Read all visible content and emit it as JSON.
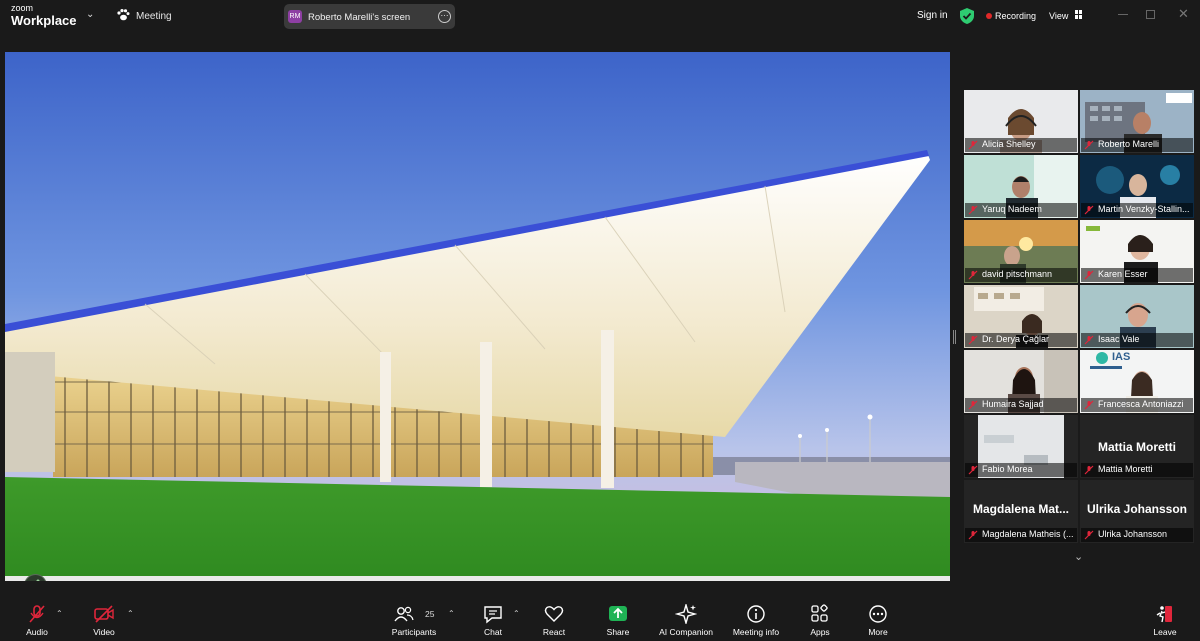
{
  "app": {
    "brand_small": "zoom",
    "brand_large": "Workplace",
    "meeting_label": "Meeting"
  },
  "screen_share": {
    "avatar_initials": "RM",
    "label": "Roberto Marelli's screen"
  },
  "top_right": {
    "sign_in": "Sign in",
    "recording": "Recording",
    "view": "View"
  },
  "gallery": {
    "tiles": [
      {
        "name": "Alicia Shelley"
      },
      {
        "name": "Roberto Marelli"
      },
      {
        "name": "Yaruq Nadeem"
      },
      {
        "name": "Martin Venzky-Stallin..."
      },
      {
        "name": "david pitschmann"
      },
      {
        "name": "Karen Esser"
      },
      {
        "name": "Dr. Derya Çağlar"
      },
      {
        "name": "Isaac Vale"
      },
      {
        "name": "Humaira Sajjad"
      },
      {
        "name": "Francesca Antoniazzi"
      },
      {
        "name": "Fabio Morea"
      },
      {
        "name": "Mattia Moretti",
        "big_name": "Mattia Moretti"
      },
      {
        "name": "Magdalena Matheis (...",
        "big_name": "Magdalena  Mat..."
      },
      {
        "name": "Ulrika Johansson",
        "big_name": "Ulrika Johansson"
      }
    ],
    "iash_logo_text": "IAS"
  },
  "toolbar": {
    "audio": "Audio",
    "video": "Video",
    "participants": "Participants",
    "participants_count": "25",
    "chat": "Chat",
    "react": "React",
    "share": "Share",
    "ai_companion": "AI Companion",
    "meeting_info": "Meeting info",
    "apps": "Apps",
    "more": "More",
    "leave": "Leave"
  },
  "colors": {
    "active_speaker": "#2ecc71",
    "share_green": "#1fb355",
    "record_red": "#e02828",
    "muted_red": "#e0263b"
  }
}
